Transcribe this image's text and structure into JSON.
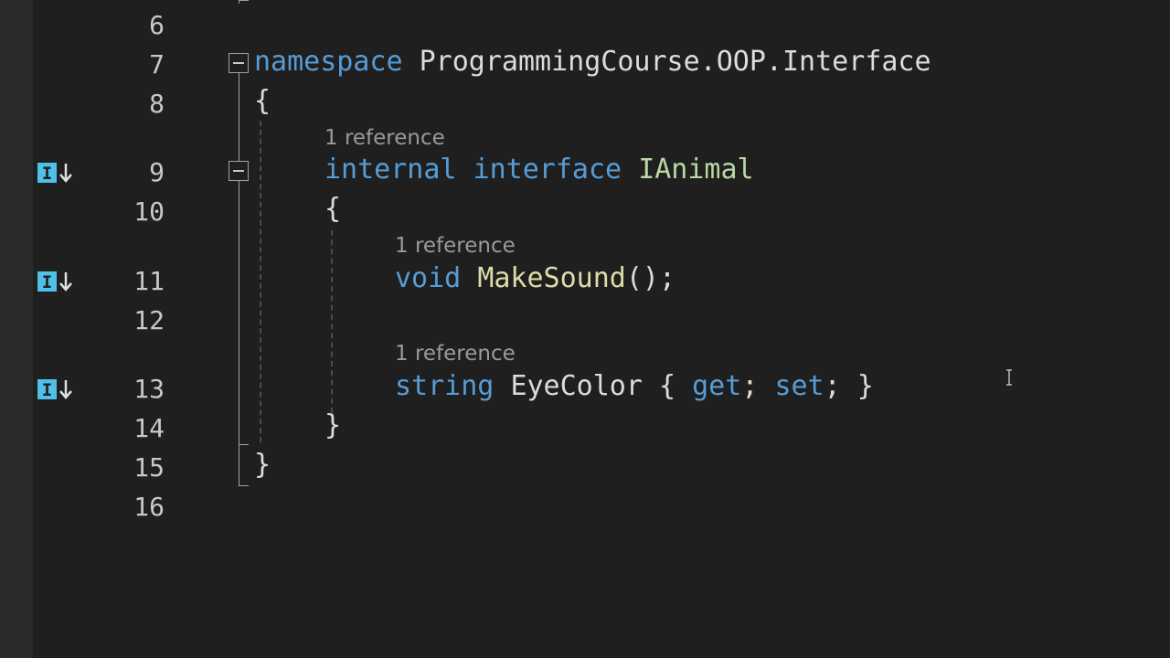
{
  "line_numbers": [
    "6",
    "7",
    "8",
    "9",
    "10",
    "11",
    "12",
    "13",
    "14",
    "15",
    "16"
  ],
  "codelens": {
    "interface": "1 reference",
    "method": "1 reference",
    "property": "1 reference"
  },
  "code": {
    "namespace_kw": "namespace",
    "namespace_name": "ProgrammingCourse.OOP.Interface",
    "ns_open": "{",
    "internal_kw": "internal",
    "interface_kw": "interface",
    "interface_name": "IAnimal",
    "iface_open": "{",
    "void_kw": "void",
    "method_name": "MakeSound",
    "method_tail": "();",
    "string_kw": "string",
    "prop_name": "EyeColor",
    "prop_open": " { ",
    "get_kw": "get",
    "semi1": "; ",
    "set_kw": "set",
    "semi2": "; }",
    "iface_close": "}",
    "ns_close": "}"
  },
  "icons": {
    "implementation_marker": "implemented-by-icon",
    "fold": "collapse-minus-icon",
    "cursor": "text-cursor-icon"
  },
  "colors": {
    "background": "#1f1f1f",
    "keyword": "#569cd6",
    "type": "#b8d7a3",
    "method": "#dcdcaa",
    "codelens": "#9a9a9a",
    "icon_accent": "#4fc1e9"
  }
}
